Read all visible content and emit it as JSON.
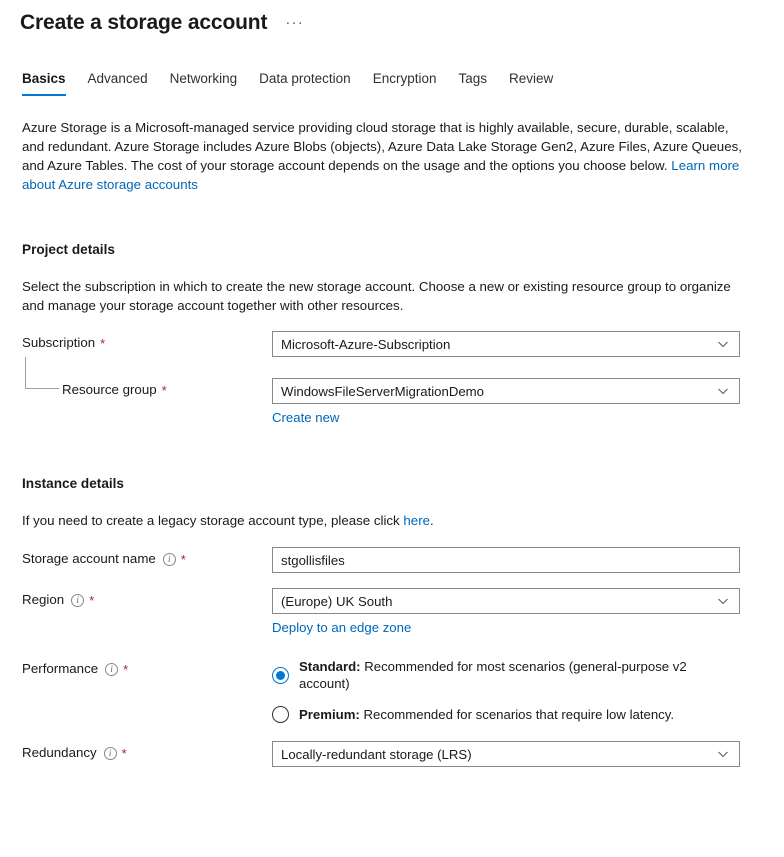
{
  "header": {
    "title": "Create a storage account",
    "more_menu": "···"
  },
  "tabs": [
    {
      "label": "Basics",
      "active": true
    },
    {
      "label": "Advanced",
      "active": false
    },
    {
      "label": "Networking",
      "active": false
    },
    {
      "label": "Data protection",
      "active": false
    },
    {
      "label": "Encryption",
      "active": false
    },
    {
      "label": "Tags",
      "active": false
    },
    {
      "label": "Review",
      "active": false
    }
  ],
  "intro": {
    "text_before_link": "Azure Storage is a Microsoft-managed service providing cloud storage that is highly available, secure, durable, scalable, and redundant. Azure Storage includes Azure Blobs (objects), Azure Data Lake Storage Gen2, Azure Files, Azure Queues, and Azure Tables. The cost of your storage account depends on the usage and the options you choose below. ",
    "link_text": "Learn more about Azure storage accounts"
  },
  "project_details": {
    "title": "Project details",
    "description": "Select the subscription in which to create the new storage account. Choose a new or existing resource group to organize and manage your storage account together with other resources.",
    "subscription": {
      "label": "Subscription",
      "required": "*",
      "value": "Microsoft-Azure-Subscription"
    },
    "resource_group": {
      "label": "Resource group",
      "required": "*",
      "value": "WindowsFileServerMigrationDemo",
      "create_new_label": "Create new"
    }
  },
  "instance_details": {
    "title": "Instance details",
    "legacy_text_before_link": "If you need to create a legacy storage account type, please click ",
    "legacy_link_text": "here",
    "legacy_text_after_link": ".",
    "storage_account_name": {
      "label": "Storage account name",
      "required": "*",
      "value": "stgollisfiles",
      "placeholder": ""
    },
    "region": {
      "label": "Region",
      "required": "*",
      "value": "(Europe) UK South",
      "edge_zone_link": "Deploy to an edge zone"
    },
    "performance": {
      "label": "Performance",
      "required": "*",
      "options": [
        {
          "bold": "Standard:",
          "rest": " Recommended for most scenarios (general-purpose v2 account)",
          "selected": true
        },
        {
          "bold": "Premium:",
          "rest": " Recommended for scenarios that require low latency.",
          "selected": false
        }
      ]
    },
    "redundancy": {
      "label": "Redundancy",
      "required": "*",
      "value": "Locally-redundant storage (LRS)"
    }
  },
  "colors": {
    "accent": "#0078d4",
    "link": "#0067b8",
    "required": "#a4262c",
    "border": "#8a8886",
    "text": "#1b1a19"
  }
}
